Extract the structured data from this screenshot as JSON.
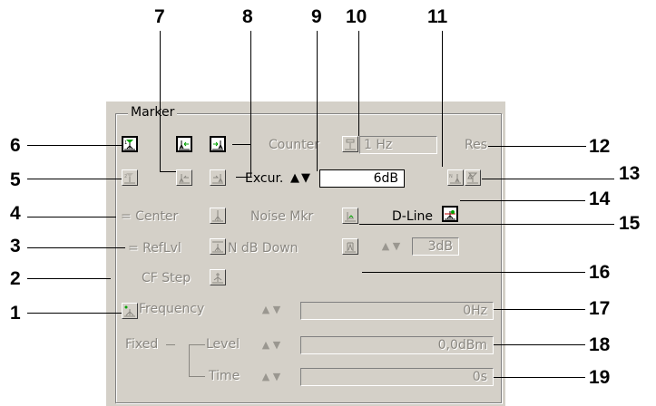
{
  "group_title": "Marker",
  "callouts": {
    "top": [
      "7",
      "8",
      "9",
      "10",
      "11"
    ],
    "right": [
      "12",
      "13",
      "14",
      "15",
      "16",
      "17",
      "18",
      "19"
    ],
    "left": [
      "6",
      "5",
      "4",
      "3",
      "2",
      "1"
    ]
  },
  "labels": {
    "counter": "Counter",
    "counter_value": "1 Hz",
    "res": "Res",
    "excur": "Excur.",
    "excur_value": "6dB",
    "center": "= Center",
    "noise_mkr": "Noise Mkr",
    "d_line": "D-Line",
    "reflvl": "= RefLvl",
    "ndb_down": "N dB Down",
    "ndb_value": "3dB",
    "cf_step": "CF Step",
    "frequency": "Frequency",
    "fixed": "Fixed",
    "level": "Level",
    "time": "Time"
  },
  "fields": {
    "frequency": "0Hz",
    "level": "0,0dBm",
    "time": "0s"
  },
  "icons": {
    "marker1": "marker-1-icon",
    "marker2": "marker-2-icon",
    "peak_left": "peak-left-icon",
    "peak_right": "peak-right-icon",
    "counter": "counter-icon",
    "next_peak": "next-peak-icon",
    "delta": "delta-marker-icon",
    "d_line": "d-line-icon"
  },
  "colors": {
    "panel": "#d4d0c8",
    "disabled_text": "#8a8781",
    "marker_green": "#00a000"
  }
}
